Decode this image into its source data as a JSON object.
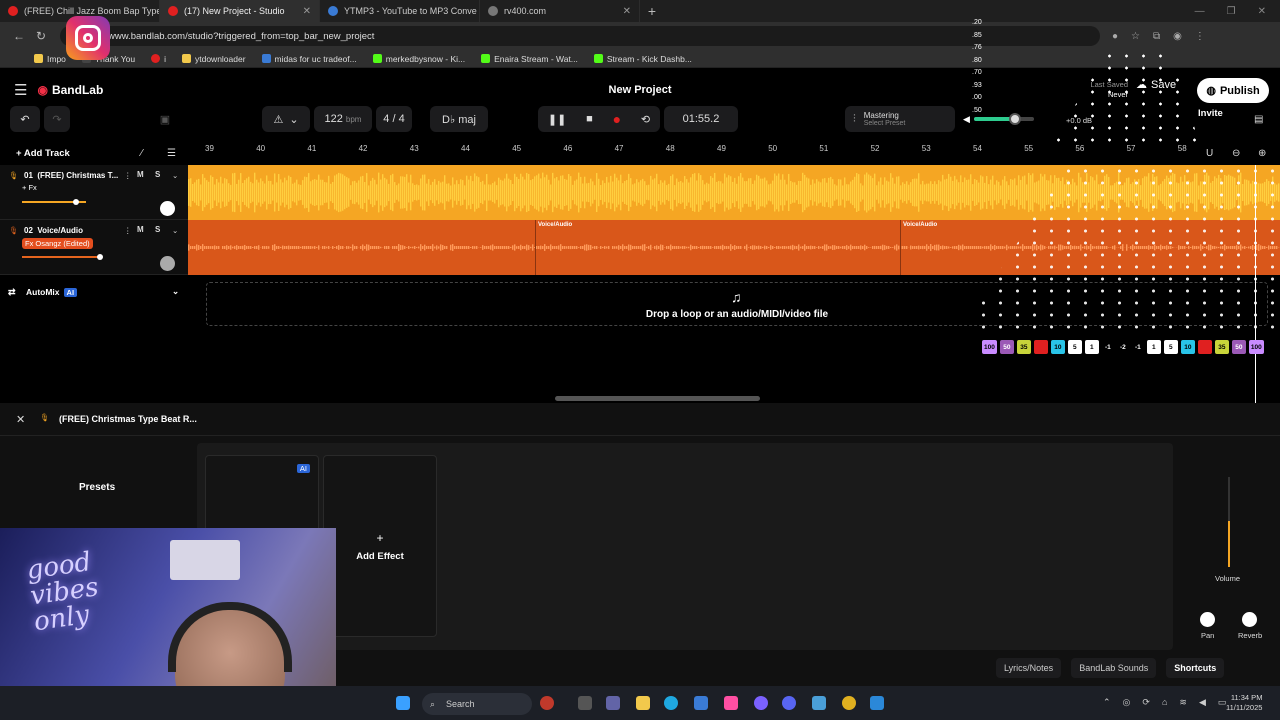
{
  "browser": {
    "tabs": [
      {
        "title": "(FREE) Chill Jazz Boom Bap Type",
        "color": "#e02020"
      },
      {
        "title": "(17) New Project - Studio",
        "color": "#e02020"
      },
      {
        "title": "YTMP3 - YouTube to MP3 Conve",
        "color": "#3a7bd5"
      },
      {
        "title": "rv400.com",
        "color": "#777777"
      }
    ],
    "url": "www.bandlab.com/studio?triggered_from=top_bar_new_project",
    "bookmarks": [
      {
        "label": "Impo",
        "color": "#f2c94c"
      },
      {
        "label": "Thank You",
        "color": "#444444"
      },
      {
        "label": "i",
        "color": "#e02020"
      },
      {
        "label": "ytdownloader",
        "color": "#f2c94c"
      },
      {
        "label": "midas for uc tradeof...",
        "color": "#3a7bd5"
      },
      {
        "label": "merkedbysnow - Ki...",
        "color": "#53fc18"
      },
      {
        "label": "Enaira Stream - Wat...",
        "color": "#53fc18"
      },
      {
        "label": "Stream - Kick Dashb...",
        "color": "#53fc18"
      }
    ]
  },
  "app": {
    "logo": "BandLab",
    "project_title": "New Project",
    "last_saved_label": "Last Saved",
    "last_saved_value": "Never",
    "save": "Save",
    "publish": "Publish",
    "invite": "Invite"
  },
  "transport": {
    "tempo": "122",
    "tempo_unit": "bpm",
    "time_signature": "4 / 4",
    "key": "D♭ maj",
    "time": "01:55.2",
    "mastering_label": "Mastering",
    "mastering_preset": "Select Preset",
    "volume_fraction": 0.68,
    "db_label": "+0.0 dB"
  },
  "ruler": {
    "add_track": "Add Track",
    "bars": [
      "39",
      "40",
      "41",
      "42",
      "43",
      "44",
      "45",
      "46",
      "47",
      "48",
      "49",
      "50",
      "51",
      "52",
      "53",
      "54",
      "55",
      "56",
      "57",
      "58"
    ]
  },
  "tracks": [
    {
      "index": "01",
      "name": "(FREE) Christmas T...",
      "fx": "+ Fx",
      "m": "M",
      "s": "S",
      "volume_fraction": 0.85,
      "color": "#f5a623"
    },
    {
      "index": "02",
      "name": "Voice/Audio",
      "fx": "Fx Osangz (Edited)",
      "m": "M",
      "s": "S",
      "volume_fraction": 1.0,
      "color": "#e4641e",
      "regions": [
        "Voice/Audio",
        "Voice/Audio"
      ]
    }
  ],
  "automix": {
    "label": "AutoMix",
    "badge": "AI"
  },
  "dropzone": {
    "text": "Drop a loop or an audio/MIDI/video file"
  },
  "overlay_numbers": {
    "right_column": [
      ".20",
      ".85",
      ".76",
      ".80",
      ".70",
      ".93",
      ".00",
      ".50"
    ],
    "badges": [
      {
        "text": "100",
        "color": "#c98bff"
      },
      {
        "text": "50",
        "color": "#9b59b6"
      },
      {
        "text": "35",
        "color": "#c8d43a"
      },
      {
        "text": "",
        "color": "#e02020"
      },
      {
        "text": "10",
        "color": "#29c4e8"
      },
      {
        "text": "5",
        "color": "#ffffff"
      },
      {
        "text": "1",
        "color": "#ffffff"
      },
      {
        "text": "-1",
        "color": ""
      },
      {
        "text": "-2",
        "color": ""
      },
      {
        "text": "-1",
        "color": ""
      },
      {
        "text": "1",
        "color": "#ffffff"
      },
      {
        "text": "5",
        "color": "#ffffff"
      },
      {
        "text": "10",
        "color": "#29c4e8"
      },
      {
        "text": "",
        "color": "#e02020"
      },
      {
        "text": "35",
        "color": "#c8d43a"
      },
      {
        "text": "50",
        "color": "#9b59b6"
      },
      {
        "text": "100",
        "color": "#c98bff"
      }
    ]
  },
  "bottom_panel": {
    "title": "(FREE) Christmas Type Beat R...",
    "presets": "Presets",
    "ai_badge": "AI",
    "add_effect": "Add Effect",
    "volume": "Volume",
    "pan": "Pan",
    "reverb": "Reverb",
    "footer": [
      "Lyrics/Notes",
      "BandLab Sounds",
      "Shortcuts"
    ]
  },
  "webcam": {
    "neon_text": "good vibes only"
  },
  "taskbar": {
    "search": "Search",
    "time": "11:34 PM",
    "date": "11/11/2025"
  }
}
